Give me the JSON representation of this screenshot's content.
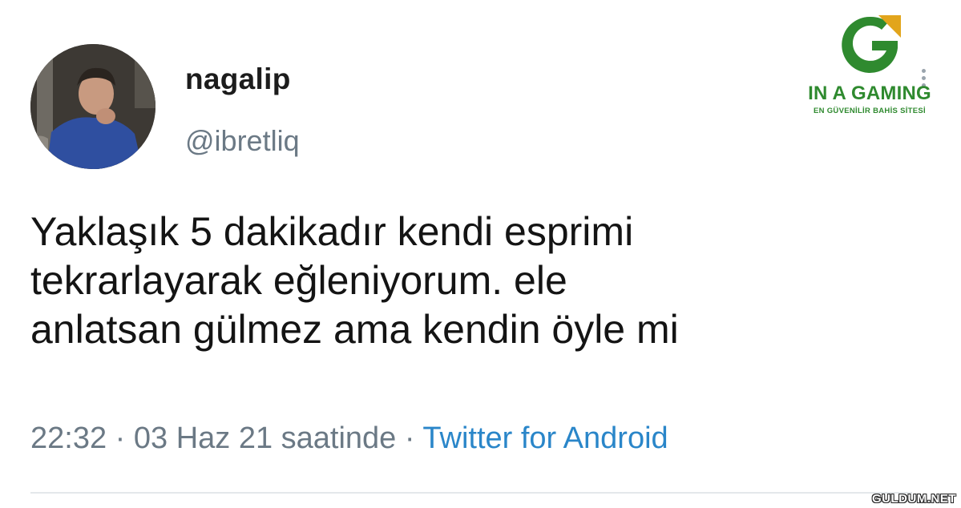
{
  "tweet": {
    "display_name": "nagalip",
    "handle": "@ibretliq",
    "text_lines": [
      "Yaklaşık 5 dakikadır kendi esprimi",
      "tekrarlayarak eğleniyorum. ele",
      "anlatsan gülmez ama kendin öyle mi"
    ],
    "timestamp": "22:32 · 03 Haz 21 saatinde ·",
    "source": "Twitter for Android"
  },
  "brand": {
    "name": "IN A GAMING",
    "tagline": "EN GÜVENİLİR BAHİS SİTESİ",
    "colors": {
      "green": "#2f8a2f",
      "gold": "#e2a51c"
    }
  },
  "watermark": "GULDUM.NET",
  "icons": {
    "avatar": "profile-photo",
    "more": "more-options-icon"
  }
}
